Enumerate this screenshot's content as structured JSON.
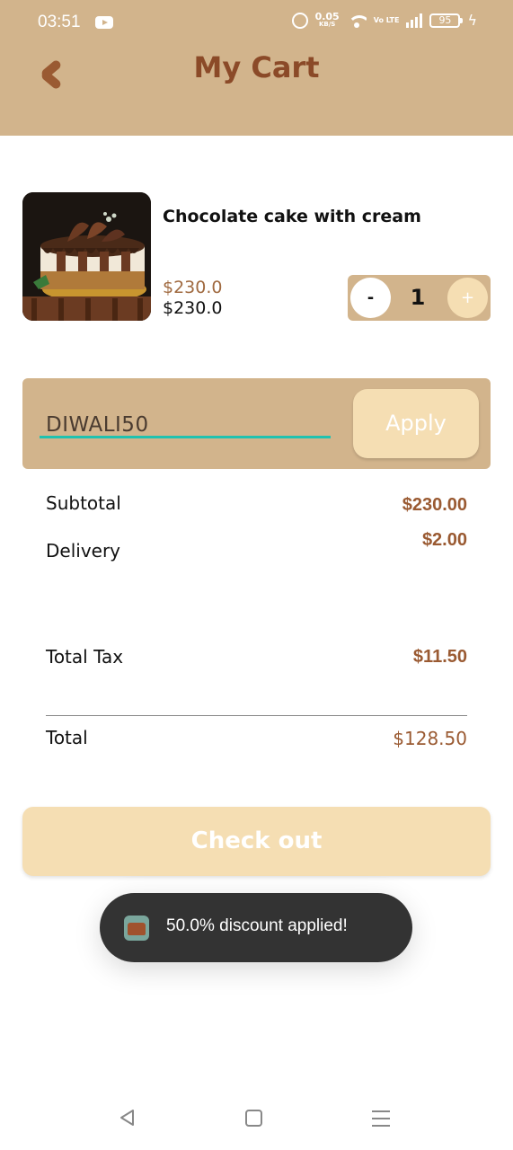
{
  "status_bar": {
    "time": "03:51",
    "speed_value": "0.05",
    "speed_unit": "KB/S",
    "volte": "Vo LTE",
    "battery": "95"
  },
  "header": {
    "title": "My Cart",
    "icons": {
      "back": "chevron-left-icon"
    }
  },
  "cart": {
    "items": [
      {
        "name": "Chocolate cake with cream",
        "price_original": "$230.0",
        "price": "$230.0",
        "quantity": "1",
        "minus_label": "-",
        "plus_label": "+"
      }
    ]
  },
  "promo": {
    "code": "DIWALI50",
    "apply_label": "Apply"
  },
  "summary": {
    "subtotal_label": "Subtotal",
    "subtotal_value": "$230.00",
    "delivery_label": "Delivery",
    "delivery_value": "$2.00",
    "tax_label": "Total Tax",
    "tax_value": "$11.50",
    "total_label": "Total",
    "total_value": "$128.50"
  },
  "checkout": {
    "label": "Check out"
  },
  "toast": {
    "message": "50.0% discount applied!"
  },
  "colors": {
    "header": "#d2b48c",
    "accent": "#9a5a32",
    "button_light": "#f5deb3",
    "input_underline": "#1fc2b0",
    "toast": "#333333"
  }
}
